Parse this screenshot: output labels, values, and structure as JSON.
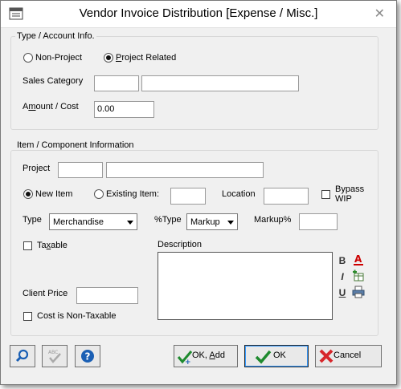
{
  "window": {
    "title": "Vendor Invoice Distribution [Expense / Misc.]"
  },
  "type_group": {
    "label": "Type / Account Info.",
    "non_project": "Non-Project",
    "project_related": "Project Related",
    "sales_category_label": "Sales Category",
    "sales_category_code": "",
    "sales_category_desc": "",
    "amount_label": "Amount / Cost",
    "amount_value": "0.00"
  },
  "item_group": {
    "label": "Item / Component Information",
    "project_label": "Project",
    "project_code": "",
    "project_desc": "",
    "new_item": "New Item",
    "existing_item": "Existing Item:",
    "existing_item_value": "",
    "location_label": "Location",
    "location_value": "",
    "bypass_wip": "Bypass WIP",
    "type_label": "Type",
    "type_value": "Merchandise",
    "pct_type_label": "%Type",
    "pct_type_value": "Markup",
    "markup_label": "Markup%",
    "markup_value": "",
    "taxable": "Taxable",
    "description_label": "Description",
    "client_price_label": "Client Price",
    "client_price_value": "",
    "cost_non_taxable": "Cost is Non-Taxable"
  },
  "buttons": {
    "ok_add": "OK, Add",
    "ok": "OK",
    "cancel": "Cancel"
  },
  "colors": {
    "accent_blue": "#1a5fb4",
    "ok_green": "#1e8a2e",
    "cancel_red": "#d7262a"
  }
}
